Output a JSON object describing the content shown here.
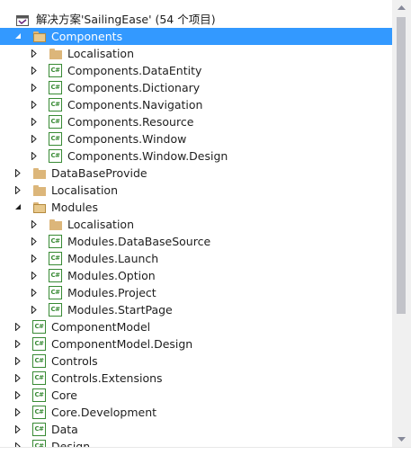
{
  "solution": {
    "label": "解决方案'SailingEase' (54 个项目)",
    "icon": "solution-icon"
  },
  "tree": [
    {
      "label": "Components",
      "icon": "folder-open-icon",
      "expanded": true,
      "selected": true,
      "level": 0
    },
    {
      "label": "Localisation",
      "icon": "folder-icon",
      "expanded": false,
      "level": 1
    },
    {
      "label": "Components.DataEntity",
      "icon": "csharp-project-icon",
      "expanded": false,
      "level": 1
    },
    {
      "label": "Components.Dictionary",
      "icon": "csharp-project-icon",
      "expanded": false,
      "level": 1
    },
    {
      "label": "Components.Navigation",
      "icon": "csharp-project-icon",
      "expanded": false,
      "level": 1
    },
    {
      "label": "Components.Resource",
      "icon": "csharp-project-icon",
      "expanded": false,
      "level": 1
    },
    {
      "label": "Components.Window",
      "icon": "csharp-project-icon",
      "expanded": false,
      "level": 1
    },
    {
      "label": "Components.Window.Design",
      "icon": "csharp-project-icon",
      "expanded": false,
      "level": 1
    },
    {
      "label": "DataBaseProvide",
      "icon": "folder-icon",
      "expanded": false,
      "level": 0
    },
    {
      "label": "Localisation",
      "icon": "folder-icon",
      "expanded": false,
      "level": 0
    },
    {
      "label": "Modules",
      "icon": "folder-open-icon",
      "expanded": true,
      "level": 0
    },
    {
      "label": "Localisation",
      "icon": "folder-icon",
      "expanded": false,
      "level": 1
    },
    {
      "label": "Modules.DataBaseSource",
      "icon": "csharp-project-icon",
      "expanded": false,
      "level": 1
    },
    {
      "label": "Modules.Launch",
      "icon": "csharp-project-icon",
      "expanded": false,
      "level": 1
    },
    {
      "label": "Modules.Option",
      "icon": "csharp-project-icon",
      "expanded": false,
      "level": 1
    },
    {
      "label": "Modules.Project",
      "icon": "csharp-project-icon",
      "expanded": false,
      "level": 1
    },
    {
      "label": "Modules.StartPage",
      "icon": "csharp-project-icon",
      "expanded": false,
      "level": 1
    },
    {
      "label": "ComponentModel",
      "icon": "csharp-project-icon",
      "expanded": false,
      "level": 0
    },
    {
      "label": "ComponentModel.Design",
      "icon": "csharp-project-icon",
      "expanded": false,
      "level": 0
    },
    {
      "label": "Controls",
      "icon": "csharp-project-icon",
      "expanded": false,
      "level": 0
    },
    {
      "label": "Controls.Extensions",
      "icon": "csharp-project-icon",
      "expanded": false,
      "level": 0
    },
    {
      "label": "Core",
      "icon": "csharp-project-icon",
      "expanded": false,
      "level": 0
    },
    {
      "label": "Core.Development",
      "icon": "csharp-project-icon",
      "expanded": false,
      "level": 0
    },
    {
      "label": "Data",
      "icon": "csharp-project-icon",
      "expanded": false,
      "level": 0
    },
    {
      "label": "Design",
      "icon": "csharp-project-icon",
      "expanded": false,
      "level": 0
    }
  ],
  "cs_glyph": "C#",
  "colors": {
    "selection": "#3399ff",
    "folder": "#dcb67a",
    "csharp": "#388a34"
  }
}
